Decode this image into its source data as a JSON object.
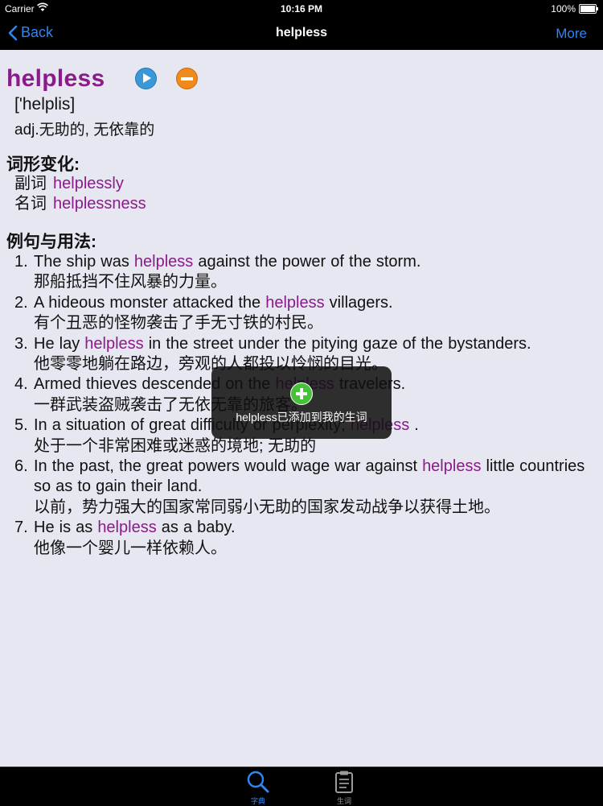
{
  "status": {
    "carrier": "Carrier",
    "time": "10:16 PM",
    "battery": "100%"
  },
  "nav": {
    "back_label": "Back",
    "title": "helpless",
    "more_label": "More"
  },
  "entry": {
    "word": "helpless",
    "phonetic": "['helplis]",
    "definition": "adj.无助的, 无依靠的",
    "forms_heading": "词形变化:",
    "forms": [
      {
        "type": "副词",
        "word": "helplessly"
      },
      {
        "type": "名词",
        "word": "helplessness"
      }
    ],
    "examples_heading": "例句与用法:",
    "examples": [
      {
        "num": "1.",
        "before": "The ship was ",
        "hl": "helpless",
        "after": " against the power of the storm.",
        "zh": "那船抵挡不住风暴的力量。"
      },
      {
        "num": "2.",
        "before": "A hideous monster attacked the ",
        "hl": "helpless",
        "after": " villagers.",
        "zh": "有个丑恶的怪物袭击了手无寸铁的村民。"
      },
      {
        "num": "3.",
        "before": "He lay ",
        "hl": "helpless",
        "after": " in the street under the pitying gaze of the bystanders.",
        "zh": "他零零地躺在路边，旁观的人都投以怜悯的目光。"
      },
      {
        "num": "4.",
        "before": "Armed thieves descended on the ",
        "hl": "helpless",
        "after": " travelers.",
        "zh": "一群武装盗贼袭击了无依无靠的旅客。"
      },
      {
        "num": "5.",
        "before": "In a situation of great difficulty or perplexity; ",
        "hl": "helpless",
        "after": " .",
        "zh": "处于一个非常困难或迷惑的境地; 无助的"
      },
      {
        "num": "6.",
        "before": "In the past, the great powers would wage war against ",
        "hl": "helpless",
        "after": " little countries so as to gain their land.",
        "zh": "以前，势力强大的国家常同弱小无助的国家发动战争以获得土地。"
      },
      {
        "num": "7.",
        "before": "He is as ",
        "hl": "helpless",
        "after": " as a baby.",
        "zh": "他像一个婴儿一样依赖人。"
      }
    ]
  },
  "toast": {
    "icon": "plus-circle-icon",
    "message": "helpless已添加到我的生词"
  },
  "tabbar": {
    "dict_label": "字典",
    "vocab_label": "生词"
  },
  "colors": {
    "accent": "#2f86f5",
    "headword": "#8b1a8a",
    "background": "#e6e7f0"
  }
}
